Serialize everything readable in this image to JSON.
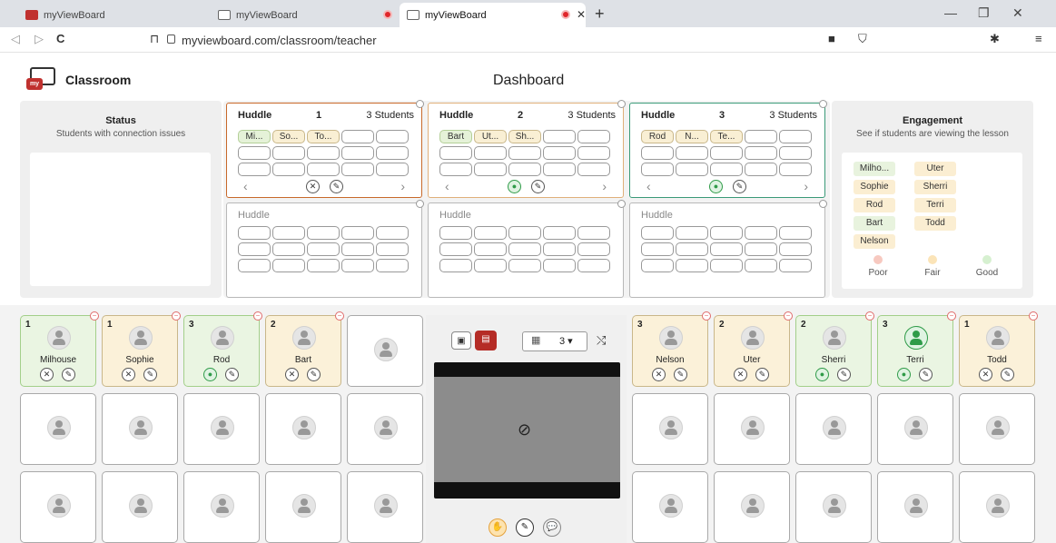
{
  "browser": {
    "tabs": [
      {
        "title": "myViewBoard",
        "active": false
      },
      {
        "title": "myViewBoard",
        "active": false
      },
      {
        "title": "myViewBoard",
        "active": true
      }
    ],
    "url": "myviewboard.com/classroom/teacher"
  },
  "app": {
    "brand_badge": "my",
    "title": "Classroom",
    "page_title": "Dashboard"
  },
  "status": {
    "title": "Status",
    "subtitle": "Students with connection issues"
  },
  "engagement": {
    "title": "Engagement",
    "subtitle": "See if students are viewing the lesson",
    "students": [
      {
        "name": "Milho...",
        "level": "good"
      },
      {
        "name": "Uter",
        "level": "fair"
      },
      {
        "name": "Sophie",
        "level": "fair"
      },
      {
        "name": "Sherri",
        "level": "fair"
      },
      {
        "name": "Rod",
        "level": "fair"
      },
      {
        "name": "Terri",
        "level": "fair"
      },
      {
        "name": "Bart",
        "level": "good"
      },
      {
        "name": "Todd",
        "level": "fair"
      },
      {
        "name": "Nelson",
        "level": "fair"
      }
    ],
    "legend": {
      "poor": "Poor",
      "fair": "Fair",
      "good": "Good"
    },
    "colors": {
      "poor": "#f7c9c0",
      "fair": "#fbe4b8",
      "good": "#d6f0d0"
    }
  },
  "huddles": [
    {
      "label": "Huddle",
      "number": "1",
      "count": "3 Students",
      "chips": [
        "Mi...",
        "So...",
        "To..."
      ],
      "chip_colors": [
        "g",
        "y",
        "y"
      ],
      "border": "#c8692a"
    },
    {
      "label": "Huddle",
      "number": "2",
      "count": "3 Students",
      "chips": [
        "Bart",
        "Ut...",
        "Sh..."
      ],
      "chip_colors": [
        "g",
        "y",
        "y"
      ],
      "border": "#e0b07a"
    },
    {
      "label": "Huddle",
      "number": "3",
      "count": "3 Students",
      "chips": [
        "Rod",
        "N...",
        "Te..."
      ],
      "chip_colors": [
        "y",
        "y",
        "y"
      ],
      "border": "#3a9a78"
    },
    {
      "label": "Huddle"
    },
    {
      "label": "Huddle"
    },
    {
      "label": "Huddle"
    }
  ],
  "students_left": [
    {
      "group": "1",
      "name": "Milhouse",
      "state": "g",
      "audio": "muted"
    },
    {
      "group": "1",
      "name": "Sophie",
      "state": "y",
      "audio": "muted"
    },
    {
      "group": "3",
      "name": "Rod",
      "state": "g",
      "audio": "talking"
    },
    {
      "group": "2",
      "name": "Bart",
      "state": "y",
      "audio": "muted"
    }
  ],
  "students_right": [
    {
      "group": "3",
      "name": "Nelson",
      "state": "y",
      "audio": "muted"
    },
    {
      "group": "2",
      "name": "Uter",
      "state": "y",
      "audio": "muted"
    },
    {
      "group": "2",
      "name": "Sherri",
      "state": "g",
      "audio": "talking"
    },
    {
      "group": "3",
      "name": "Terri",
      "state": "g",
      "audio": "talking"
    },
    {
      "group": "1",
      "name": "Todd",
      "state": "y",
      "audio": "muted"
    }
  ],
  "control": {
    "grid_selector": "3"
  }
}
